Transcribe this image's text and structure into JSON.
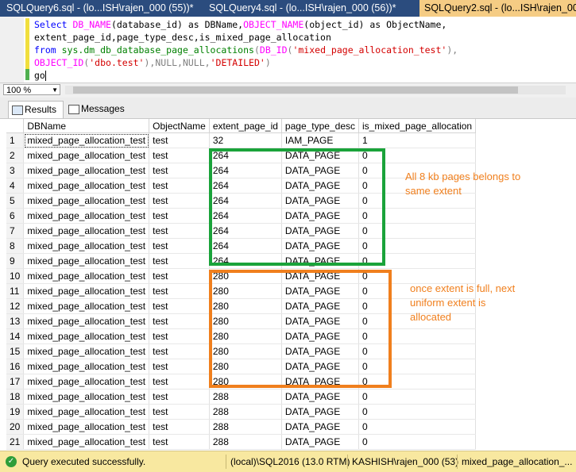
{
  "tabs": [
    "SQLQuery6.sql - (lo...ISH\\rajen_000 (55))*",
    "SQLQuery4.sql - (lo...ISH\\rajen_000 (56))*",
    "SQLQuery2.sql - (lo...ISH\\rajen_000 (5"
  ],
  "editor": {
    "lines": [
      [
        "Select ",
        "DB_NAME",
        "(database_id) as DBName,",
        "OBJECT_NAME",
        "(object_id) as ObjectName,"
      ],
      [
        "extent_page_id,page_type_desc,is_mixed_page_allocation"
      ],
      [
        "from ",
        "sys.dm_db_database_page_allocations",
        "(",
        "DB_ID",
        "(",
        "'mixed_page_allocation_test'",
        "),"
      ],
      [
        "OBJECT_ID",
        "(",
        "'dbo.test'",
        "),NULL,NULL,",
        "'DETAILED'",
        ")"
      ],
      [
        "go"
      ]
    ]
  },
  "zoom": "100 %",
  "result_tabs": [
    "Results",
    "Messages"
  ],
  "grid": {
    "columns": [
      "",
      "DBName",
      "ObjectName",
      "extent_page_id",
      "page_type_desc",
      "is_mixed_page_allocation"
    ],
    "rows": [
      [
        "1",
        "mixed_page_allocation_test",
        "test",
        "32",
        "IAM_PAGE",
        "1"
      ],
      [
        "2",
        "mixed_page_allocation_test",
        "test",
        "264",
        "DATA_PAGE",
        "0"
      ],
      [
        "3",
        "mixed_page_allocation_test",
        "test",
        "264",
        "DATA_PAGE",
        "0"
      ],
      [
        "4",
        "mixed_page_allocation_test",
        "test",
        "264",
        "DATA_PAGE",
        "0"
      ],
      [
        "5",
        "mixed_page_allocation_test",
        "test",
        "264",
        "DATA_PAGE",
        "0"
      ],
      [
        "6",
        "mixed_page_allocation_test",
        "test",
        "264",
        "DATA_PAGE",
        "0"
      ],
      [
        "7",
        "mixed_page_allocation_test",
        "test",
        "264",
        "DATA_PAGE",
        "0"
      ],
      [
        "8",
        "mixed_page_allocation_test",
        "test",
        "264",
        "DATA_PAGE",
        "0"
      ],
      [
        "9",
        "mixed_page_allocation_test",
        "test",
        "264",
        "DATA_PAGE",
        "0"
      ],
      [
        "10",
        "mixed_page_allocation_test",
        "test",
        "280",
        "DATA_PAGE",
        "0"
      ],
      [
        "11",
        "mixed_page_allocation_test",
        "test",
        "280",
        "DATA_PAGE",
        "0"
      ],
      [
        "12",
        "mixed_page_allocation_test",
        "test",
        "280",
        "DATA_PAGE",
        "0"
      ],
      [
        "13",
        "mixed_page_allocation_test",
        "test",
        "280",
        "DATA_PAGE",
        "0"
      ],
      [
        "14",
        "mixed_page_allocation_test",
        "test",
        "280",
        "DATA_PAGE",
        "0"
      ],
      [
        "15",
        "mixed_page_allocation_test",
        "test",
        "280",
        "DATA_PAGE",
        "0"
      ],
      [
        "16",
        "mixed_page_allocation_test",
        "test",
        "280",
        "DATA_PAGE",
        "0"
      ],
      [
        "17",
        "mixed_page_allocation_test",
        "test",
        "280",
        "DATA_PAGE",
        "0"
      ],
      [
        "18",
        "mixed_page_allocation_test",
        "test",
        "288",
        "DATA_PAGE",
        "0"
      ],
      [
        "19",
        "mixed_page_allocation_test",
        "test",
        "288",
        "DATA_PAGE",
        "0"
      ],
      [
        "20",
        "mixed_page_allocation_test",
        "test",
        "288",
        "DATA_PAGE",
        "0"
      ],
      [
        "21",
        "mixed_page_allocation_test",
        "test",
        "288",
        "DATA_PAGE",
        "0"
      ]
    ]
  },
  "annotations": {
    "green_note": [
      "All 8 kb pages belongs to",
      "same extent"
    ],
    "orange_note": [
      "once extent is full, next",
      "uniform extent is",
      "allocated"
    ],
    "colors": {
      "green": "#1aa33a",
      "orange": "#f07f1d"
    }
  },
  "status": {
    "message": "Query executed successfully.",
    "server": "(local)\\SQL2016 (13.0 RTM)",
    "user": "KASHISH\\rajen_000 (53)",
    "database": "mixed_page_allocation_..."
  }
}
